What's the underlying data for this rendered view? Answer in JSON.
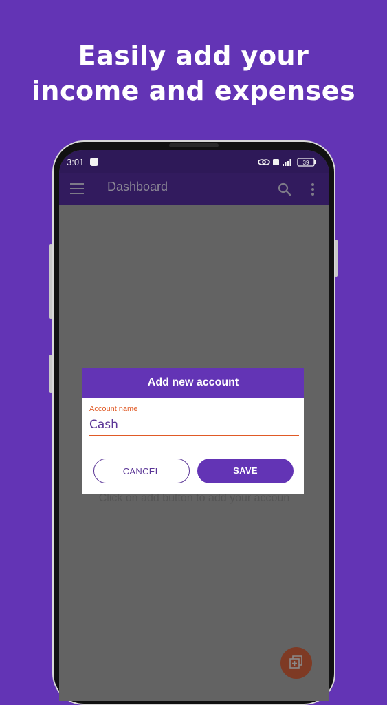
{
  "headline": {
    "line1": "Easily add your",
    "line2": "income and expenses"
  },
  "status_bar": {
    "time": "3:01",
    "battery": "39"
  },
  "app_bar": {
    "title": "Dashboard",
    "menu_icon": "hamburger-menu-icon",
    "search_icon": "search-icon",
    "more_icon": "more-vert-icon"
  },
  "empty_state_text": "Click on add button to add your accoun",
  "dialog": {
    "title": "Add new account",
    "field_label": "Account name",
    "field_value": "Cash",
    "cancel_label": "CANCEL",
    "save_label": "SAVE"
  },
  "fab_icon": "add-account-icon",
  "colors": {
    "background": "#6334b5",
    "accent": "#e05a26",
    "app_bar": "#321b5e"
  }
}
